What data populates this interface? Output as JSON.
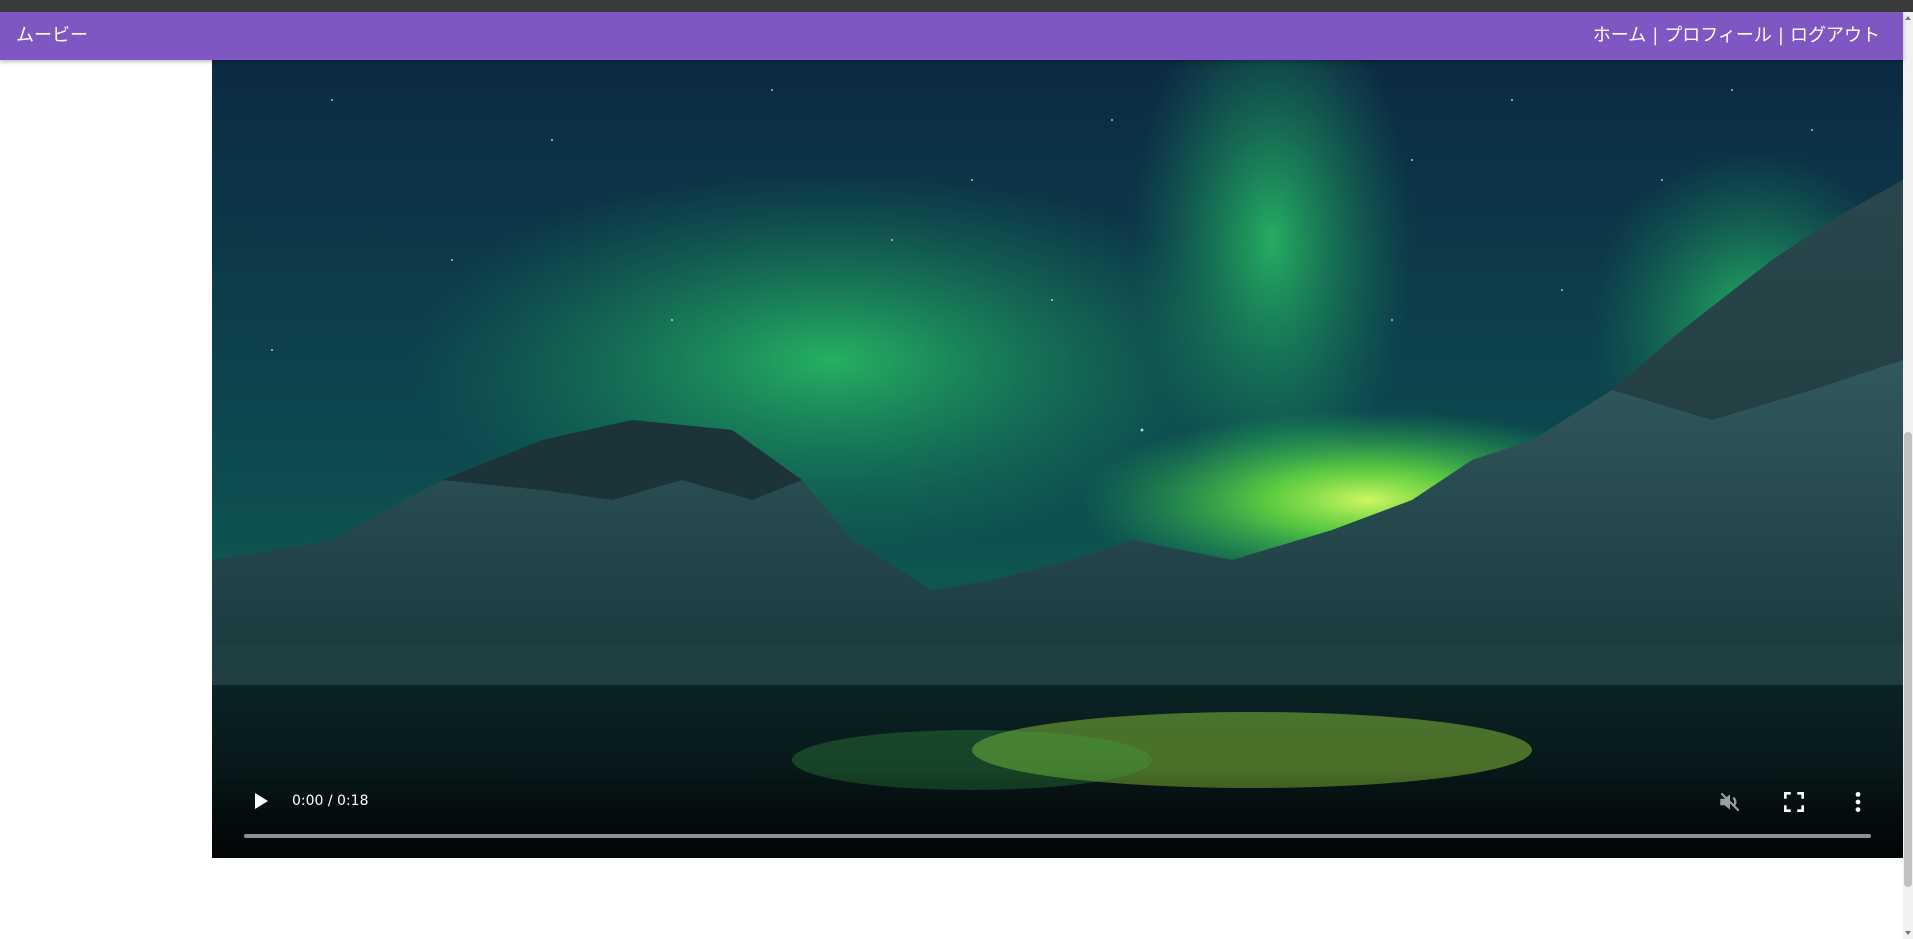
{
  "app": {
    "brand": "ムービー"
  },
  "nav": {
    "home": "ホーム",
    "profile": "プロフィール",
    "logout": "ログアウト",
    "separator": "|"
  },
  "video": {
    "current_time": "0:00",
    "duration": "0:18",
    "time_display": "0:00 / 0:18",
    "progress": 0,
    "muted": true,
    "icons": {
      "play": "play-icon",
      "mute": "volume-muted-icon",
      "fullscreen": "fullscreen-icon",
      "more": "more-vertical-icon"
    }
  },
  "colors": {
    "appbar": "#7e57c2",
    "appbar_text": "#ffffff",
    "video_bg": "#08141a",
    "aurora": "#3cff6a"
  }
}
